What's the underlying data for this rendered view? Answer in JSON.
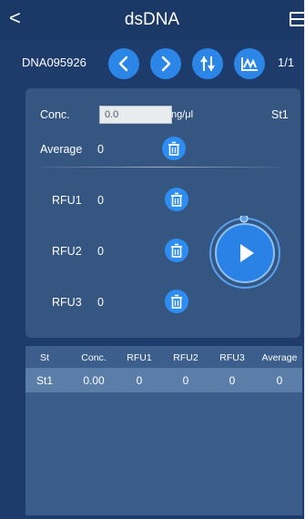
{
  "header": {
    "back_label": "<",
    "title": "dsDNA"
  },
  "toolbar": {
    "sample_id": "DNA095926",
    "page_count": "1/1"
  },
  "panel": {
    "conc_label": "Conc.",
    "conc_value": "0.0",
    "conc_unit": "ng/μl",
    "standard": "St1",
    "average_label": "Average",
    "average_value": "0",
    "rfu": [
      {
        "label": "RFU1",
        "value": "0"
      },
      {
        "label": "RFU2",
        "value": "0"
      },
      {
        "label": "RFU3",
        "value": "0"
      }
    ]
  },
  "table": {
    "columns": [
      "St",
      "Conc.",
      "RFU1",
      "RFU2",
      "RFU3",
      "Average"
    ],
    "rows": [
      [
        "St1",
        "0.00",
        "0",
        "0",
        "0",
        "0"
      ]
    ]
  },
  "colors": {
    "background": "#1d3c6c",
    "panel": "#365682",
    "accent": "#2b86e8",
    "selected_row": "#5b7ea8"
  },
  "icons": [
    "back-icon",
    "menu-icon",
    "previous-icon",
    "next-icon",
    "adjust-icon",
    "curve-icon",
    "trash-icon",
    "play-icon"
  ]
}
